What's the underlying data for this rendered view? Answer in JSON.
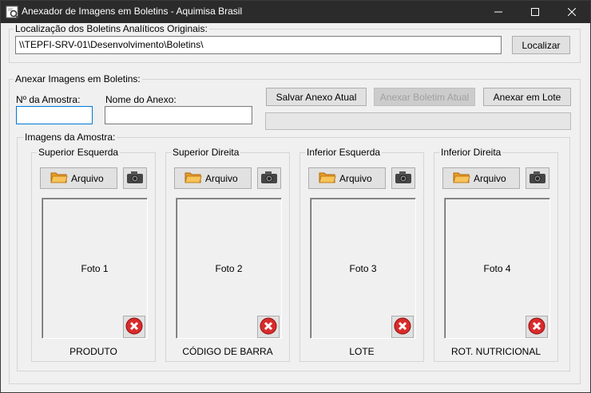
{
  "window": {
    "title": "Anexador de Imagens em Boletins - Aquimisa Brasil",
    "controls": {
      "minimize_icon": "minimize-icon",
      "maximize_icon": "maximize-icon",
      "close_icon": "close-icon"
    }
  },
  "location_group": {
    "label": "Localização dos Boletins Analíticos Originais:",
    "path_value": "\\\\TEPFI-SRV-01\\Desenvolvimento\\Boletins\\",
    "locate_button": "Localizar"
  },
  "attach_group": {
    "label": "Anexar Imagens em Boletins:",
    "sample_number_label": "Nº da Amostra:",
    "sample_number_value": "",
    "attachment_name_label": "Nome do Anexo:",
    "attachment_name_value": "",
    "save_button": "Salvar Anexo Atual",
    "attach_current_button": "Anexar Boletim Atual",
    "attach_batch_button": "Anexar em Lote",
    "progress": 0
  },
  "images_group": {
    "label": "Imagens da Amostra:",
    "file_button_label": "Arquivo",
    "panels": [
      {
        "title": "Superior Esquerda",
        "photo": "Foto 1",
        "caption": "PRODUTO"
      },
      {
        "title": "Superior Direita",
        "photo": "Foto 2",
        "caption": "CÓDIGO DE BARRA"
      },
      {
        "title": "Inferior Esquerda",
        "photo": "Foto 3",
        "caption": "LOTE"
      },
      {
        "title": "Inferior Direita",
        "photo": "Foto 4",
        "caption": "ROT. NUTRICIONAL"
      }
    ]
  },
  "colors": {
    "titlebar": "#2b2b2b",
    "window_bg": "#f0f0f0",
    "button_bg": "#e1e1e1",
    "delete_red": "#d92b2b",
    "folder_orange": "#f0a030"
  }
}
